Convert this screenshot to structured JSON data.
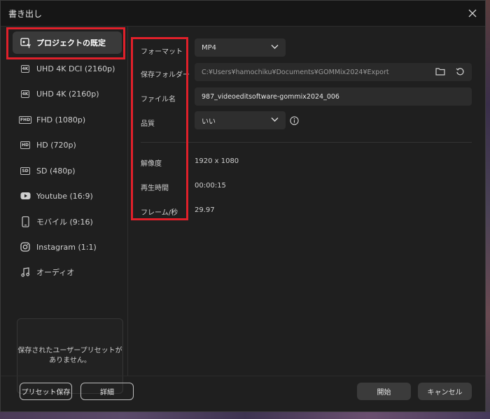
{
  "window": {
    "title": "書き出し"
  },
  "sidebar": {
    "items": [
      {
        "label": "プロジェクトの既定",
        "icon": "project-default-icon"
      },
      {
        "label": "UHD 4K DCI (2160p)",
        "badge": "4K"
      },
      {
        "label": "UHD 4K (2160p)",
        "badge": "4K"
      },
      {
        "label": "FHD (1080p)",
        "badge": "FHD"
      },
      {
        "label": "HD (720p)",
        "badge": "HD"
      },
      {
        "label": "SD (480p)",
        "badge": "SD"
      },
      {
        "label": "Youtube (16:9)",
        "icon": "youtube-icon"
      },
      {
        "label": "モバイル (9:16)",
        "icon": "mobile-icon"
      },
      {
        "label": "Instagram (1:1)",
        "icon": "instagram-icon"
      },
      {
        "label": "オーディオ",
        "icon": "music-note-icon"
      }
    ],
    "preset_empty_line1": "保存されたユーザープリセットが",
    "preset_empty_line2": "ありません。"
  },
  "settings": {
    "format_label": "フォーマット",
    "format_value": "MP4",
    "folder_label": "保存フォルダー",
    "folder_value": "C:¥Users¥hamochiku¥Documents¥GOMMix2024¥Export",
    "filename_label": "ファイル名",
    "filename_value": "987_videoeditsoftware-gommix2024_006",
    "quality_label": "品質",
    "quality_value": "いい",
    "resolution_label": "解像度",
    "resolution_value": "1920  x  1080",
    "duration_label": "再生時間",
    "duration_value": "00:00:15",
    "fps_label": "フレーム/秒",
    "fps_value": "29.97"
  },
  "footer": {
    "save_preset": "プリセット保存",
    "details": "詳細",
    "start": "開始",
    "cancel": "キャンセル"
  },
  "colors": {
    "highlight_red": "#e0202a",
    "dialog_bg": "#1f1f1f"
  }
}
